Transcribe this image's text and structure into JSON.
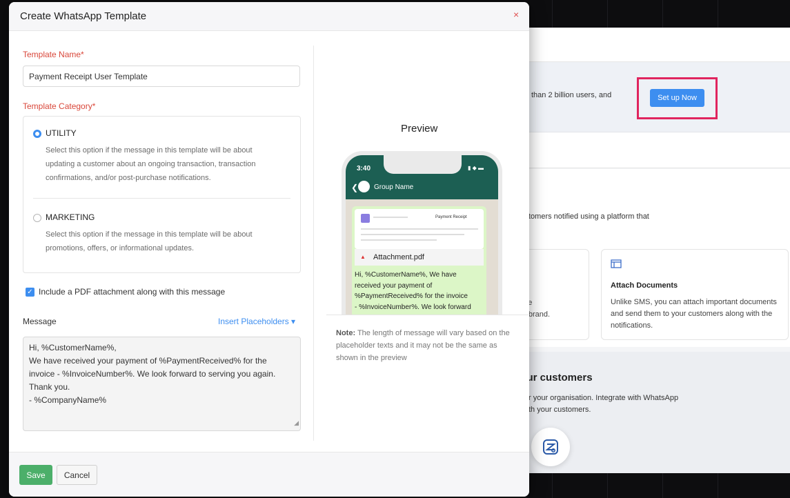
{
  "modal": {
    "title": "Create WhatsApp Template",
    "close_label": "×"
  },
  "form": {
    "template_name_label": "Template Name*",
    "template_name_value": "Payment Receipt User Template",
    "category_label": "Template Category*",
    "categories": [
      {
        "label": "UTILITY",
        "selected": true,
        "desc_lines": [
          "Select this option if the message in this template will be about",
          "updating a customer about an ongoing transaction, transaction",
          "confirmations, and/or post-purchase notifications."
        ]
      },
      {
        "label": "MARKETING",
        "selected": false,
        "desc_lines": [
          "Select this option if the message in this template will be about",
          "promotions, offers, or informational updates."
        ]
      }
    ],
    "pdf_checkbox_label": "Include a PDF attachment along with this message",
    "pdf_checked": true,
    "message_label": "Message",
    "insert_placeholders": "Insert Placeholders ▾",
    "message_lines": [
      "Hi, %CustomerName%,",
      "We have received your payment of %PaymentReceived% for the",
      "invoice - %InvoiceNumber%. We look forward to serving you again.",
      "Thank you.",
      "- %CompanyName%"
    ]
  },
  "preview": {
    "title": "Preview",
    "phone_time": "3:40",
    "phone_status": "▮ ◆ ▬",
    "group_name": "Group Name",
    "receipt_title": "Payment Receipt",
    "attachment_name": "Attachment.pdf",
    "bubble_lines": [
      "Hi, %CustomerName%, We have",
      "received your payment of",
      "%PaymentReceived% for the invoice",
      "- %InvoiceNumber%. We look forward"
    ],
    "note_label": "Note:",
    "note_text": " The length of message will vary based on the placeholder texts and it may not be the same as shown in the preview"
  },
  "footer": {
    "save": "Save",
    "cancel": "Cancel"
  },
  "background_page": {
    "banner_text": "than 2 billion users, and",
    "setup_button": "Set up Now",
    "notify_text": "tomers notified using a platform that",
    "card1_lines": [
      "age",
      "ur brand."
    ],
    "card2_title": "Attach Documents",
    "card2_desc": "Unlike SMS, you can attach important documents and send them to your customers along with the notifications.",
    "lower_title": "your customers",
    "lower_lines": [
      "r your organisation. Integrate with WhatsApp",
      "th your customers."
    ]
  },
  "colors": {
    "accent": "#3d8ef0",
    "required_label": "#d9473a",
    "save_green": "#4caf6a",
    "highlight": "#e0245e",
    "whatsapp_header": "#1c5f53"
  }
}
